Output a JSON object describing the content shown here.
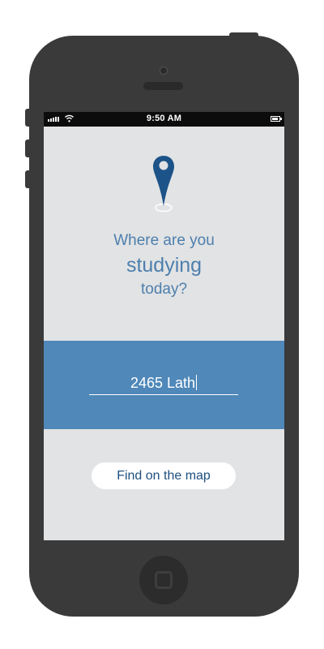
{
  "status_bar": {
    "time": "9:50 AM"
  },
  "prompt": {
    "line1": "Where are you",
    "line2": "studying",
    "line3": "today?"
  },
  "location_input": {
    "value": "2465 Lath"
  },
  "find_button": {
    "label": "Find on the map"
  },
  "colors": {
    "screen_background": "#e2e3e4",
    "accent_blue": "#4f88b9",
    "pin_blue": "#1c5388",
    "text_blue": "#4d7fad",
    "phone_body": "#3a3a3a"
  },
  "icons": [
    "signal-icon",
    "wifi-icon",
    "battery-icon",
    "map-pin-icon",
    "home-button-icon"
  ]
}
